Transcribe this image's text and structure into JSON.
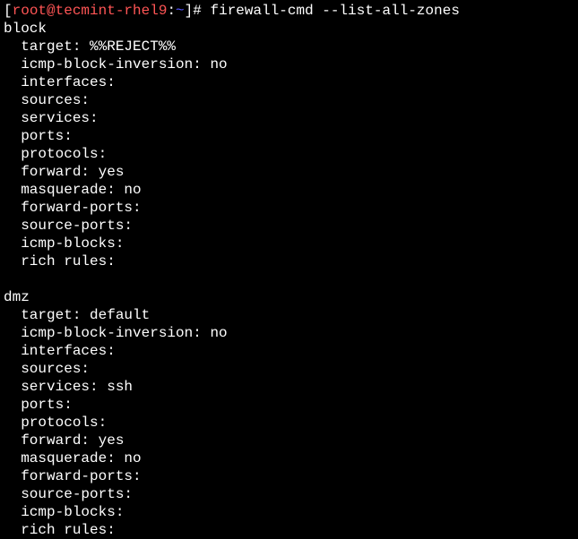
{
  "prompt": {
    "open_bracket": "[",
    "user_host": "root@tecmint-rhel9",
    "colon": ":",
    "cwd": "~",
    "close_bracket": "]",
    "symbol": "#",
    "command": "firewall-cmd --list-all-zones"
  },
  "zones": [
    {
      "name": "block",
      "properties": [
        "target: %%REJECT%%",
        "icmp-block-inversion: no",
        "interfaces:",
        "sources:",
        "services:",
        "ports:",
        "protocols:",
        "forward: yes",
        "masquerade: no",
        "forward-ports:",
        "source-ports:",
        "icmp-blocks:",
        "rich rules:"
      ]
    },
    {
      "name": "dmz",
      "properties": [
        "target: default",
        "icmp-block-inversion: no",
        "interfaces:",
        "sources:",
        "services: ssh",
        "ports:",
        "protocols:",
        "forward: yes",
        "masquerade: no",
        "forward-ports:",
        "source-ports:",
        "icmp-blocks:",
        "rich rules:"
      ]
    }
  ]
}
